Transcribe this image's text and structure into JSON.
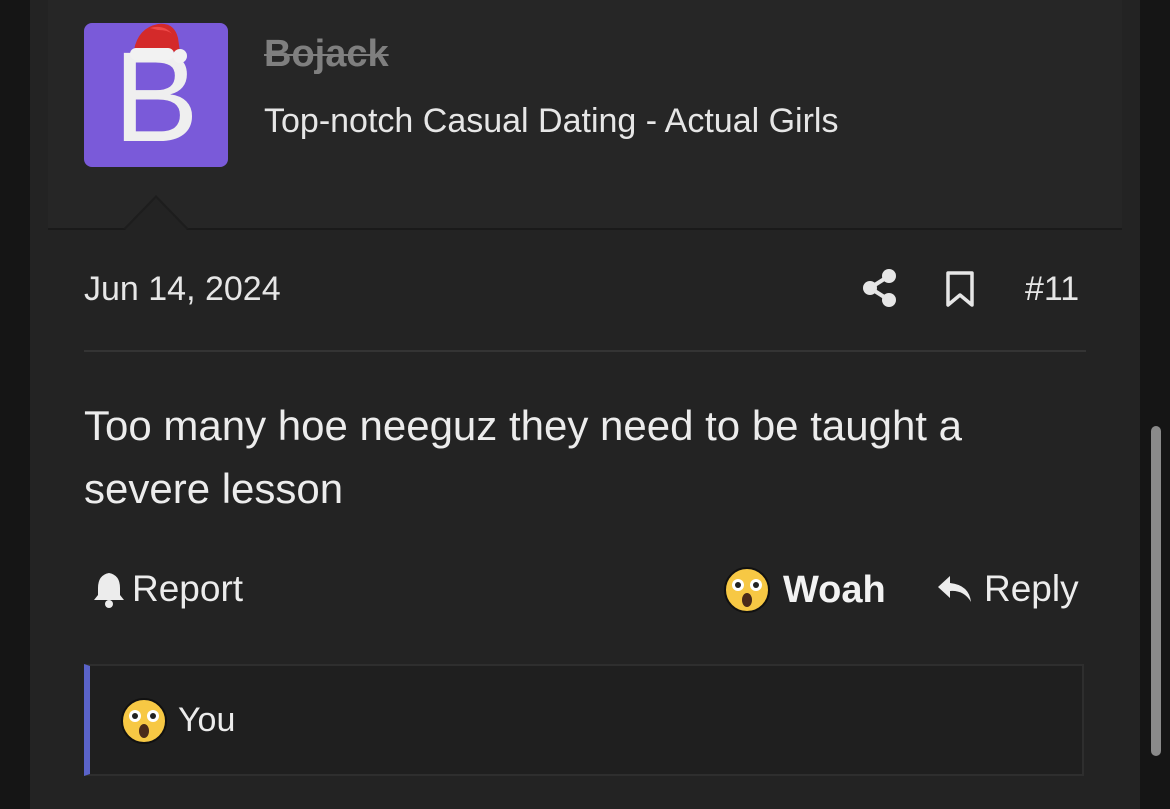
{
  "post": {
    "avatar_letter": "B",
    "username": "Bojack",
    "user_title": "Top-notch Casual Dating - Actual Girls",
    "date": "Jun 14, 2024",
    "post_number": "#11",
    "body": "Too many hoe neeguz they need to be taught a severe lesson"
  },
  "actions": {
    "report_label": "Report",
    "reaction_label": "Woah",
    "reply_label": "Reply"
  },
  "reactions_bar": {
    "reactor_label": "You",
    "emoji_icon": "astonished-face-icon"
  },
  "colors": {
    "avatar_bg": "#7a5ad9",
    "accent_bar": "#5a63c9",
    "background": "#232323"
  }
}
